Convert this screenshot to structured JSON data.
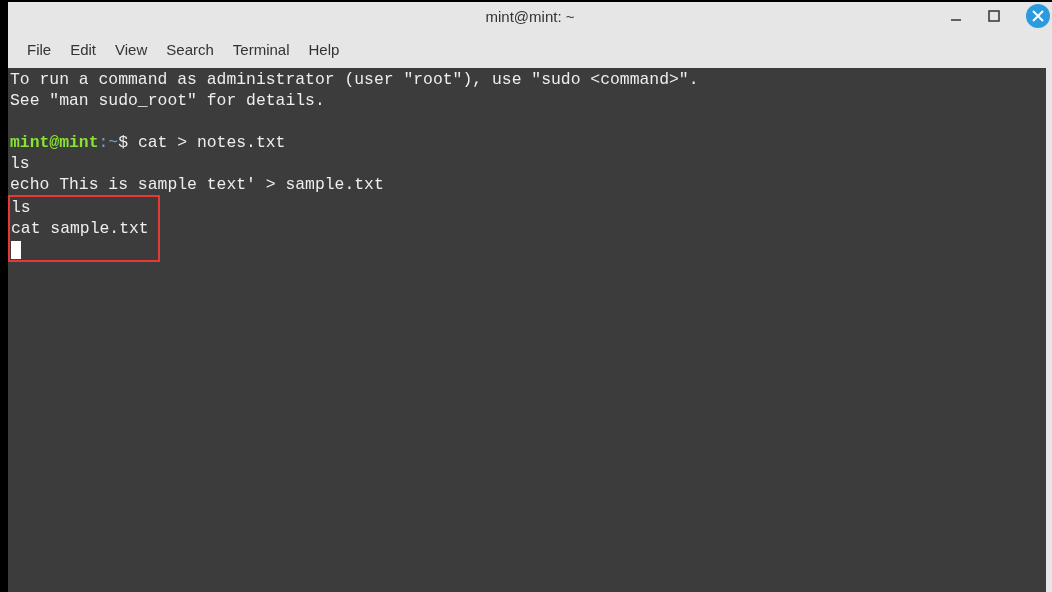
{
  "window": {
    "title": "mint@mint: ~"
  },
  "menu": [
    "File",
    "Edit",
    "View",
    "Search",
    "Terminal",
    "Help"
  ],
  "terminal": {
    "lines": [
      {
        "kind": "text",
        "highlighted": false,
        "text": "To run a command as administrator (user \"root\"), use \"sudo <command>\"."
      },
      {
        "kind": "text",
        "highlighted": false,
        "text": "See \"man sudo_root\" for details."
      },
      {
        "kind": "blank",
        "highlighted": false
      },
      {
        "kind": "prompt",
        "highlighted": false,
        "user": "mint@mint",
        "path": ":~",
        "text": "$ cat > notes.txt"
      },
      {
        "kind": "text",
        "highlighted": false,
        "text": "ls"
      },
      {
        "kind": "text",
        "highlighted": false,
        "text": "echo This is sample text' > sample.txt"
      },
      {
        "kind": "text",
        "highlighted": true,
        "text": "ls"
      },
      {
        "kind": "text",
        "highlighted": true,
        "text": "cat sample.txt"
      },
      {
        "kind": "cursor",
        "highlighted": true
      }
    ]
  }
}
